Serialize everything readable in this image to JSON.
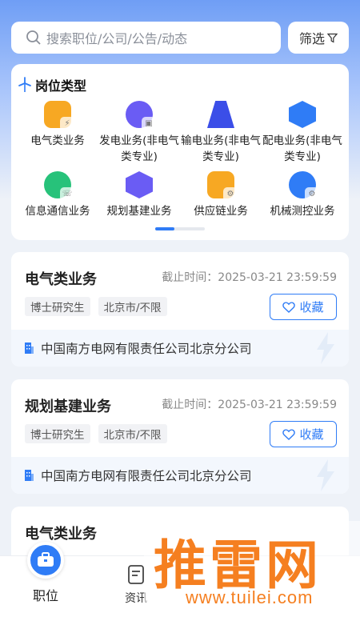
{
  "search": {
    "placeholder": "搜索职位/公司/公告/动态",
    "filter_label": "筛选"
  },
  "categories": {
    "title": "岗位类型",
    "items": [
      {
        "label": "电气类业务",
        "color": "#f7a823"
      },
      {
        "label": "发电业务(非电气类专业)",
        "color": "#6a5cf4"
      },
      {
        "label": "输电业务(非电气类专业)",
        "color": "#3b4ee8"
      },
      {
        "label": "配电业务(非电气类专业)",
        "color": "#2f7cf6"
      },
      {
        "label": "信息通信业务",
        "color": "#27c27a"
      },
      {
        "label": "规划基建业务",
        "color": "#6a5cf4"
      },
      {
        "label": "供应链业务",
        "color": "#f7a823"
      },
      {
        "label": "机械测控业务",
        "color": "#2f7cf6"
      }
    ]
  },
  "jobs": [
    {
      "title": "电气类业务",
      "deadline": "截止时间：2025-03-21 23:59:59",
      "tags": [
        "博士研究生",
        "北京市/不限"
      ],
      "fav_label": "收藏",
      "company": "中国南方电网有限责任公司北京分公司"
    },
    {
      "title": "规划基建业务",
      "deadline": "截止时间：2025-03-21 23:59:59",
      "tags": [
        "博士研究生",
        "北京市/不限"
      ],
      "fav_label": "收藏",
      "company": "中国南方电网有限责任公司北京分公司"
    },
    {
      "title": "电气类业务"
    }
  ],
  "tabs": [
    {
      "label": "职位"
    },
    {
      "label": "资讯"
    }
  ],
  "watermark": {
    "text": "推雷网",
    "url": "www.tuilei.com"
  },
  "colors": {
    "accent": "#2f7cf6",
    "watermark": "#f57f20"
  }
}
